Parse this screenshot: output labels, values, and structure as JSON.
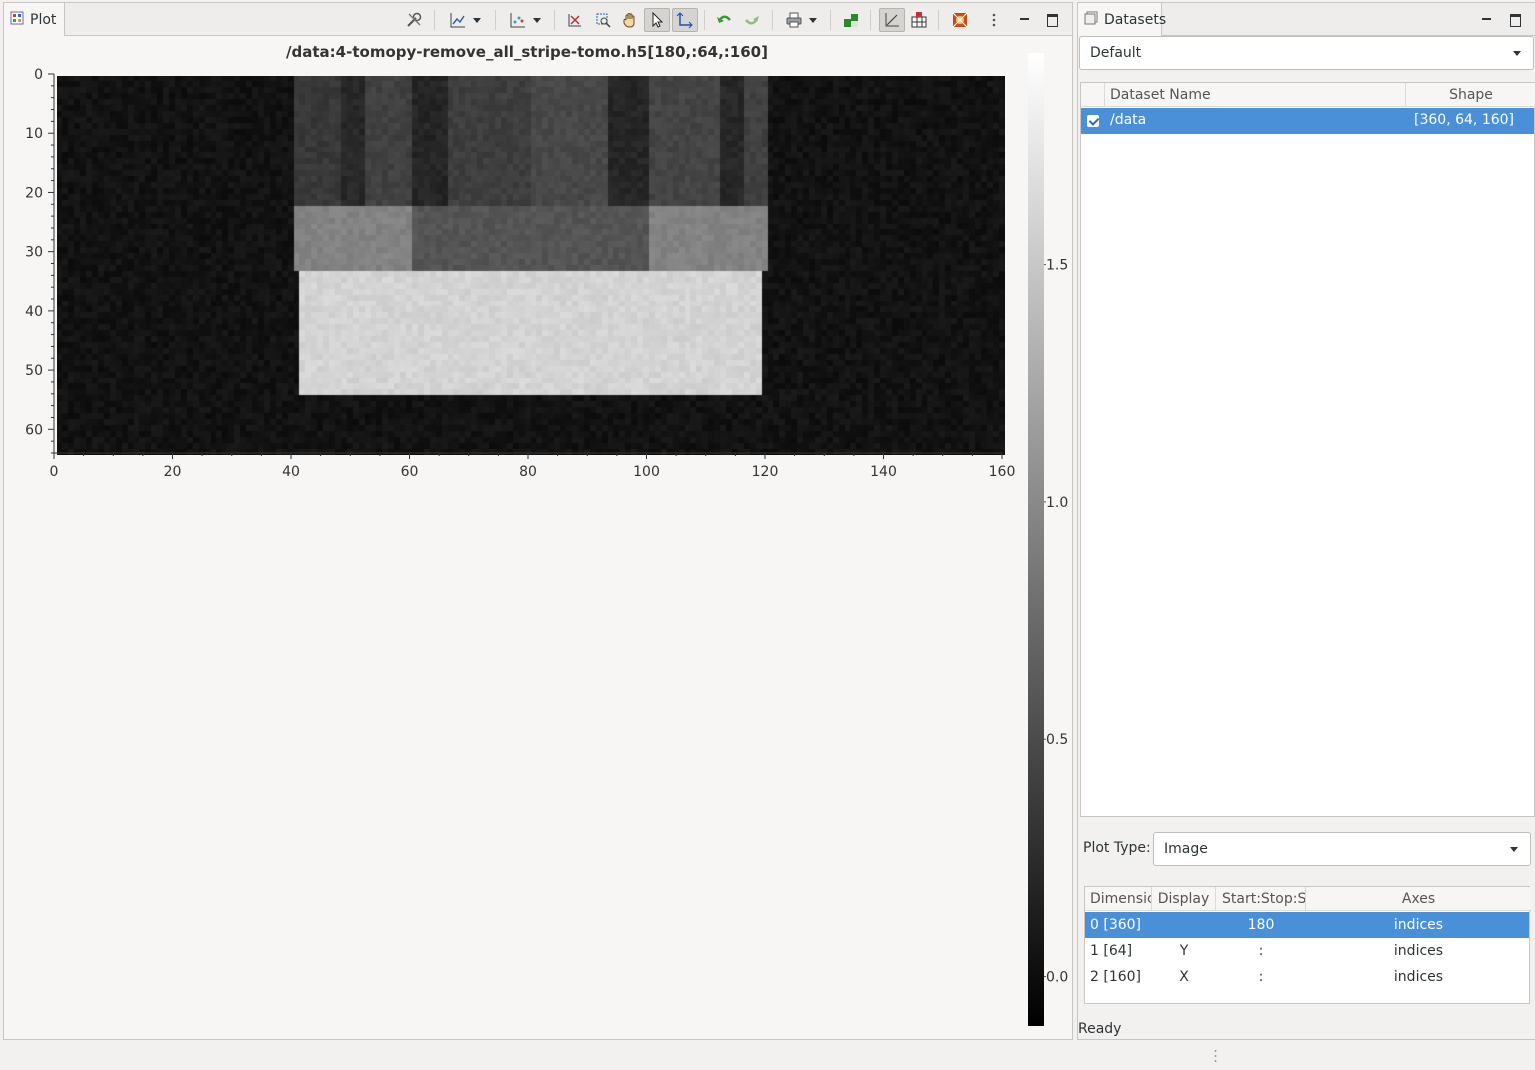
{
  "plot_panel": {
    "tab_title": "Plot",
    "plot_title": "/data:4-tomopy-remove_all_stripe-tomo.h5[180,:64,:160]"
  },
  "datasets_panel": {
    "tab_title": "Datasets",
    "preset_select": "Default",
    "table_headers": {
      "name": "Dataset Name",
      "shape": "Shape"
    },
    "datasets": [
      {
        "checked": true,
        "name": "/data",
        "shape": "[360, 64, 160]"
      }
    ],
    "plot_type_label": "Plot Type:",
    "plot_type_value": "Image",
    "dim_headers": {
      "dimension": "Dimensic",
      "display": "Display",
      "slice": "Start:Stop:S",
      "axes": "Axes"
    },
    "dims": [
      {
        "dimension": "0 [360]",
        "display": "",
        "slice": "180",
        "axes": "indices",
        "selected": true
      },
      {
        "dimension": "1 [64]",
        "display": "Y",
        "slice": ":",
        "axes": "indices",
        "selected": false
      },
      {
        "dimension": "2 [160]",
        "display": "X",
        "slice": ":",
        "axes": "indices",
        "selected": false
      }
    ],
    "status": "Ready"
  },
  "colors": {
    "selection": "#4a90d9",
    "undo_green": "#3c9a2e"
  },
  "chart_data": {
    "type": "heatmap",
    "title": "/data:4-tomopy-remove_all_stripe-tomo.h5[180,:64,:160]",
    "x_ticks": [
      0,
      20,
      40,
      60,
      80,
      100,
      120,
      140,
      160
    ],
    "y_ticks": [
      0,
      10,
      20,
      30,
      40,
      50,
      60
    ],
    "xlim": [
      0,
      160
    ],
    "ylim": [
      0,
      64
    ],
    "y_inverted": true,
    "colormap": "gray",
    "colorbar_ticks": [
      0.0,
      0.5,
      1.0,
      1.5
    ],
    "colorbar_tick_labels": [
      "0.0",
      "0.5",
      "1.0",
      "1.5"
    ],
    "colorbar_range": [
      -0.1,
      1.95
    ],
    "background_value": 0.05,
    "regions": [
      {
        "x": [
          40,
          48
        ],
        "y": [
          0,
          22
        ],
        "value": 0.35
      },
      {
        "x": [
          48,
          52
        ],
        "y": [
          0,
          22
        ],
        "value": 0.22
      },
      {
        "x": [
          52,
          60
        ],
        "y": [
          0,
          22
        ],
        "value": 0.42
      },
      {
        "x": [
          60,
          66
        ],
        "y": [
          0,
          22
        ],
        "value": 0.2
      },
      {
        "x": [
          66,
          80
        ],
        "y": [
          0,
          22
        ],
        "value": 0.4
      },
      {
        "x": [
          80,
          93
        ],
        "y": [
          0,
          22
        ],
        "value": 0.48
      },
      {
        "x": [
          93,
          100
        ],
        "y": [
          0,
          22
        ],
        "value": 0.2
      },
      {
        "x": [
          100,
          112
        ],
        "y": [
          0,
          22
        ],
        "value": 0.45
      },
      {
        "x": [
          112,
          116
        ],
        "y": [
          0,
          22
        ],
        "value": 0.22
      },
      {
        "x": [
          116,
          120
        ],
        "y": [
          0,
          22
        ],
        "value": 0.42
      },
      {
        "x": [
          40,
          60
        ],
        "y": [
          22,
          33
        ],
        "value": 0.95
      },
      {
        "x": [
          60,
          100
        ],
        "y": [
          22,
          33
        ],
        "value": 0.58
      },
      {
        "x": [
          100,
          120
        ],
        "y": [
          22,
          33
        ],
        "value": 0.95
      },
      {
        "x": [
          41,
          119
        ],
        "y": [
          33,
          54
        ],
        "value": 1.6
      }
    ]
  }
}
